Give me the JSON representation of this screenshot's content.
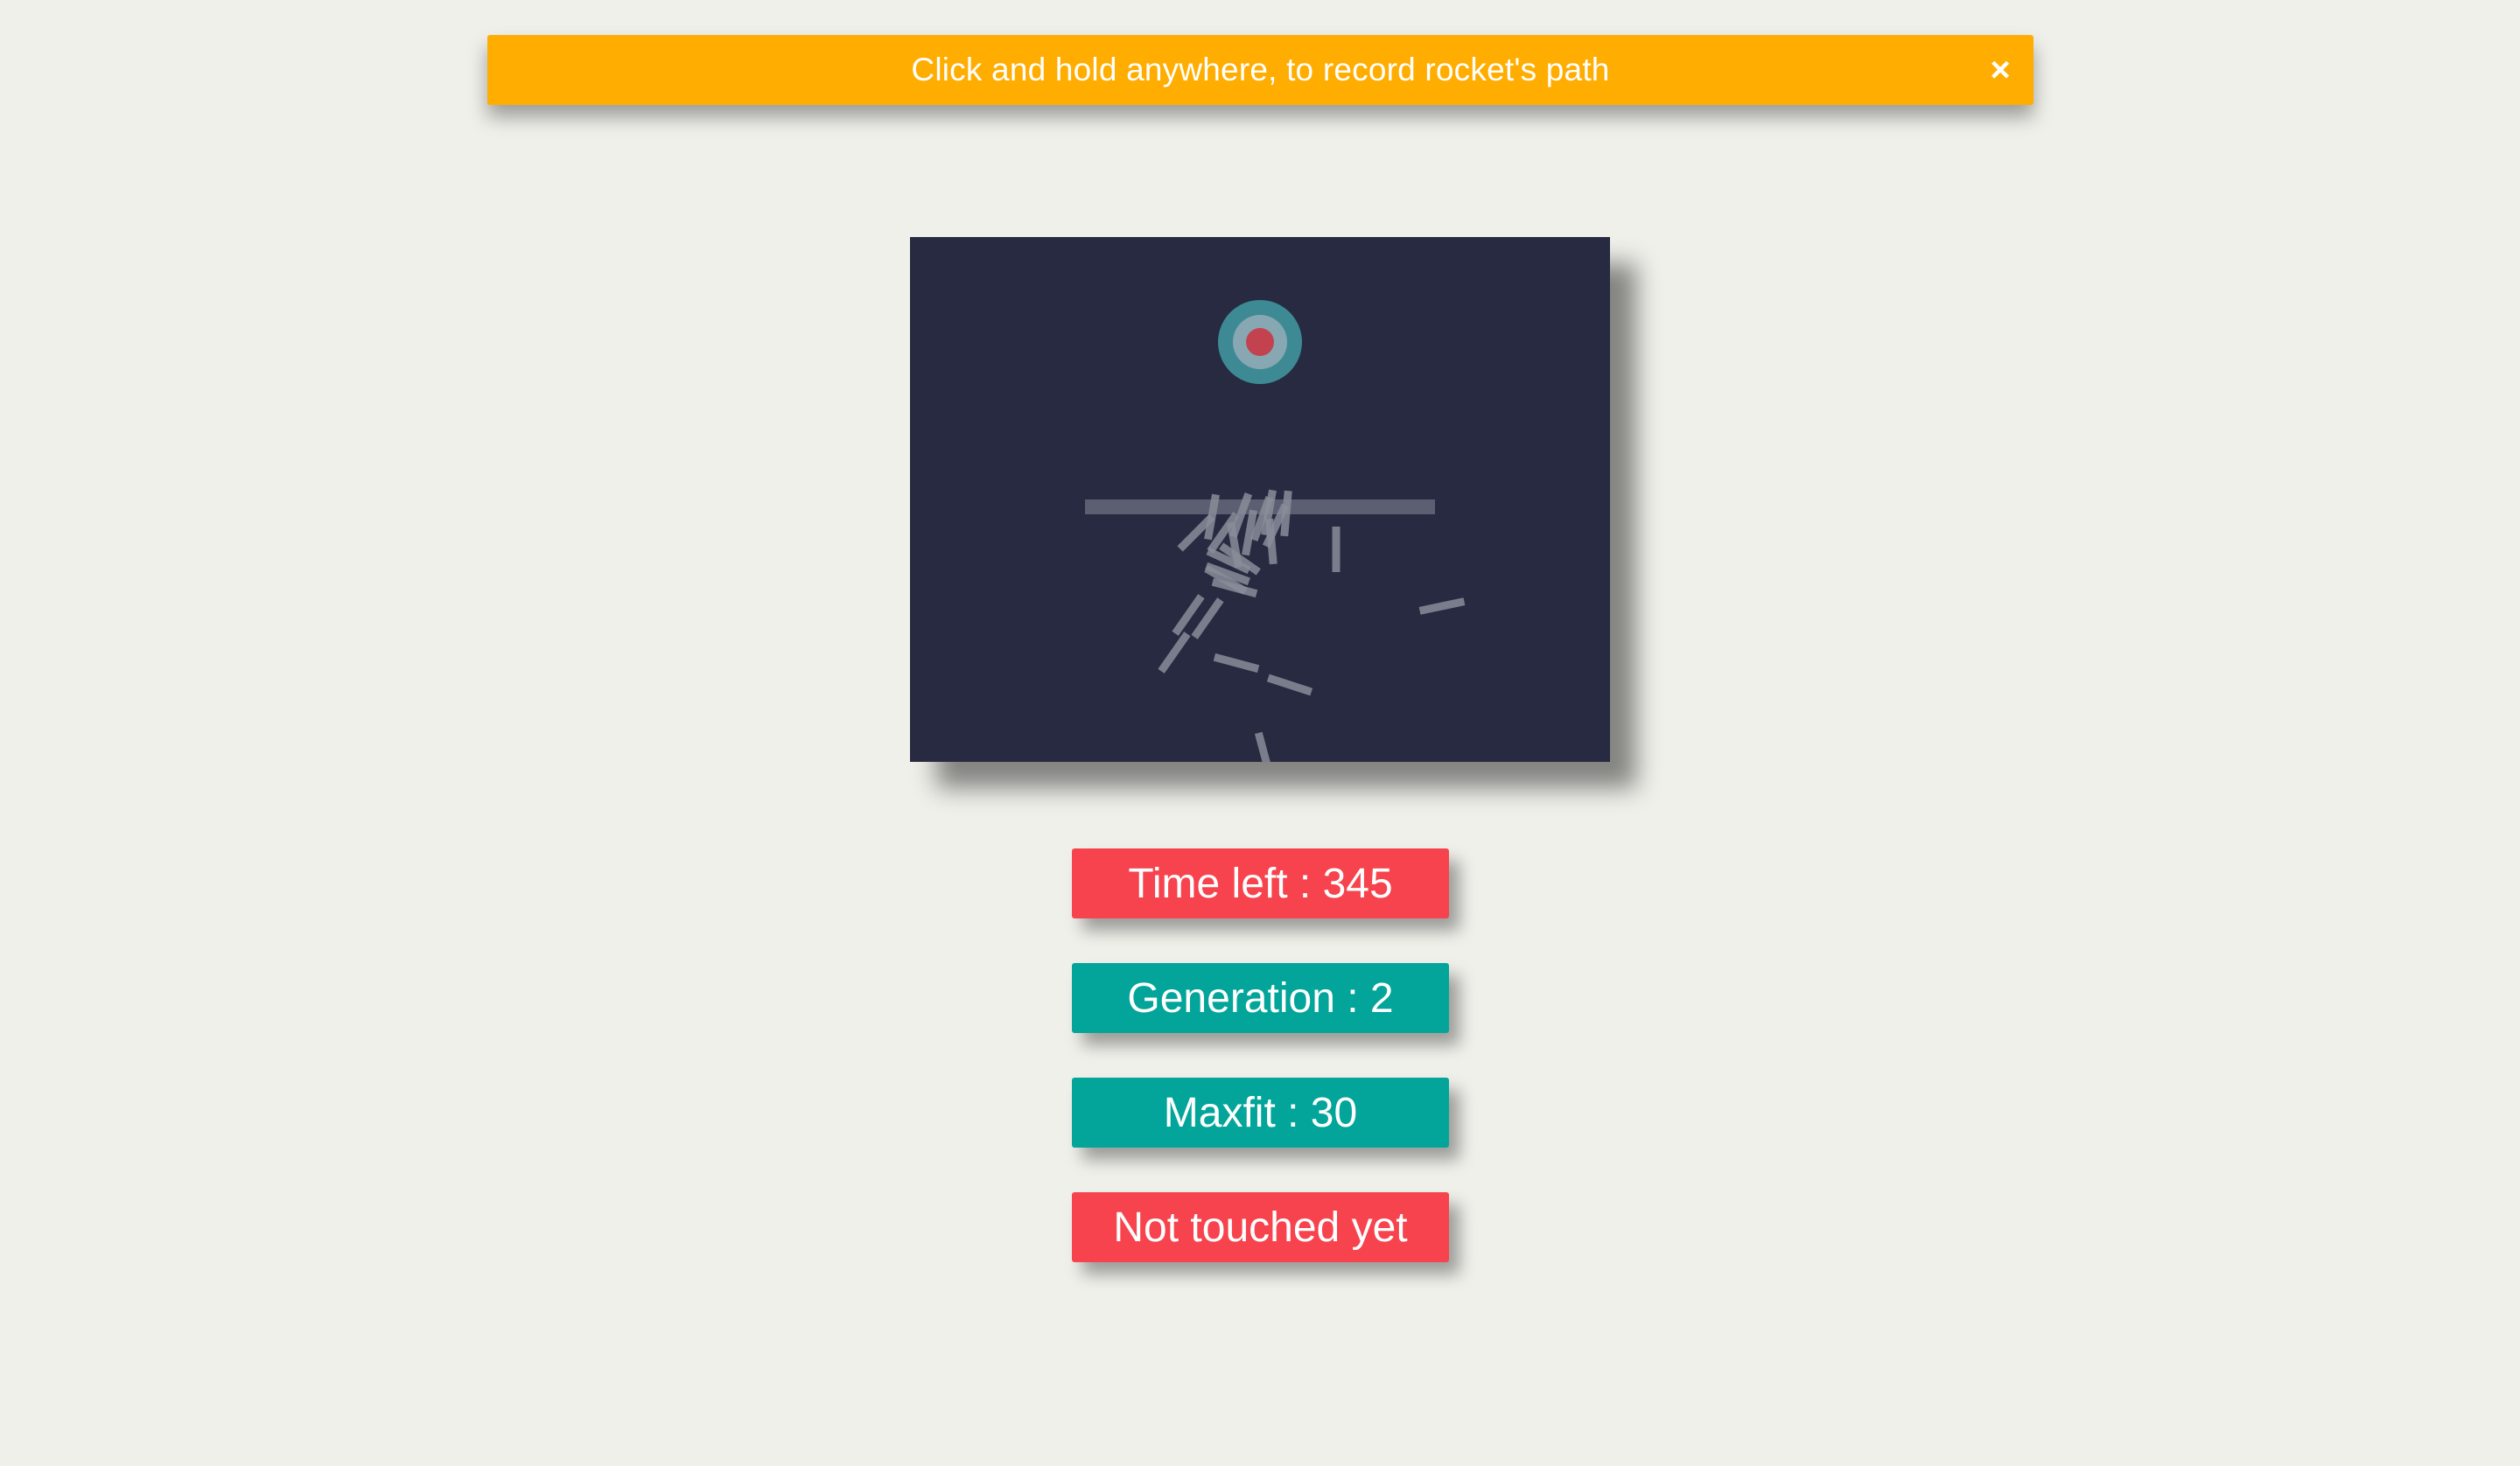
{
  "banner": {
    "message": "Click and hold anywhere, to record rocket's path",
    "close_glyph": "×",
    "background_color": "#ffad00"
  },
  "simulation": {
    "background_color": "#272a40",
    "target_colors": {
      "outer_ring": "#3e8a94",
      "middle_ring": "#87a8b2",
      "center": "#c2434f"
    },
    "obstacle_color": "#5c5f72",
    "rocket_color": "#8a8c99"
  },
  "stats": {
    "time_left": "Time left : 345",
    "generation": "Generation : 2",
    "maxfit": "Maxfit : 30",
    "status": "Not touched yet"
  },
  "colors": {
    "alert_red": "#f7434d",
    "teal": "#03a59a",
    "page_background": "#f0f0eb"
  }
}
